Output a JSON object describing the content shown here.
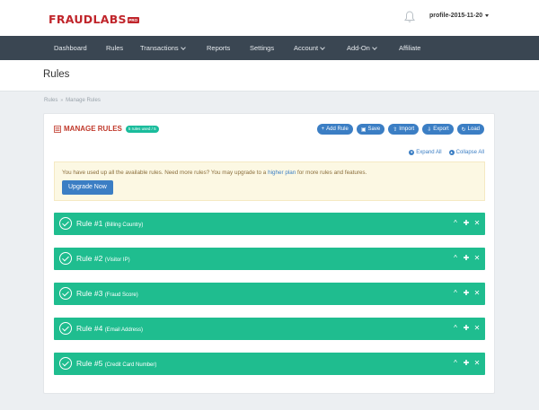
{
  "brand": {
    "name": "FRAUDLABS",
    "badge": "PRO"
  },
  "header": {
    "profile_label": "profile-2015-11-20"
  },
  "nav": {
    "items": [
      {
        "label": "Dashboard",
        "dropdown": false
      },
      {
        "label": "Rules",
        "dropdown": false
      },
      {
        "label": "Transactions",
        "dropdown": true
      },
      {
        "label": "Reports",
        "dropdown": false
      },
      {
        "label": "Settings",
        "dropdown": false
      },
      {
        "label": "Account",
        "dropdown": true
      },
      {
        "label": "Add-On",
        "dropdown": true
      },
      {
        "label": "Affiliate",
        "dropdown": false
      }
    ]
  },
  "page": {
    "title": "Rules"
  },
  "breadcrumb": {
    "items": [
      "Rules",
      "Manage Rules"
    ],
    "separator": "»"
  },
  "panel": {
    "title": "MANAGE RULES",
    "usage_badge": "5 rules used / 5",
    "toolbar": [
      {
        "label": "Add Rule",
        "icon": "plus-icon",
        "glyph": "+"
      },
      {
        "label": "Save",
        "icon": "save-icon",
        "glyph": "▣"
      },
      {
        "label": "Import",
        "icon": "upload-icon",
        "glyph": "⇧"
      },
      {
        "label": "Export",
        "icon": "download-icon",
        "glyph": "⇩"
      },
      {
        "label": "Load",
        "icon": "load-icon",
        "glyph": "↻"
      }
    ],
    "expand_all": "Expand All",
    "collapse_all": "Collapse All"
  },
  "alert": {
    "text_before": "You have used up all the available rules. Need more rules? You may upgrade to a ",
    "link": "higher plan",
    "text_after": " for more rules and features.",
    "button": "Upgrade Now"
  },
  "rules": [
    {
      "label": "Rule #1",
      "field": "(Billing Country)"
    },
    {
      "label": "Rule #2",
      "field": "(Visitor IP)"
    },
    {
      "label": "Rule #3",
      "field": "(Fraud Score)"
    },
    {
      "label": "Rule #4",
      "field": "(Email Address)"
    },
    {
      "label": "Rule #5",
      "field": "(Credit Card Number)"
    }
  ],
  "rule_actions": {
    "collapse": "^",
    "move": "✚",
    "delete": "✕"
  },
  "colors": {
    "brand": "#c0252b",
    "nav_bg": "#3a4652",
    "rule_bg": "#1fbd8f",
    "button": "#3b7ec4",
    "alert_bg": "#fcf8e3",
    "badge": "#1abc9c"
  }
}
